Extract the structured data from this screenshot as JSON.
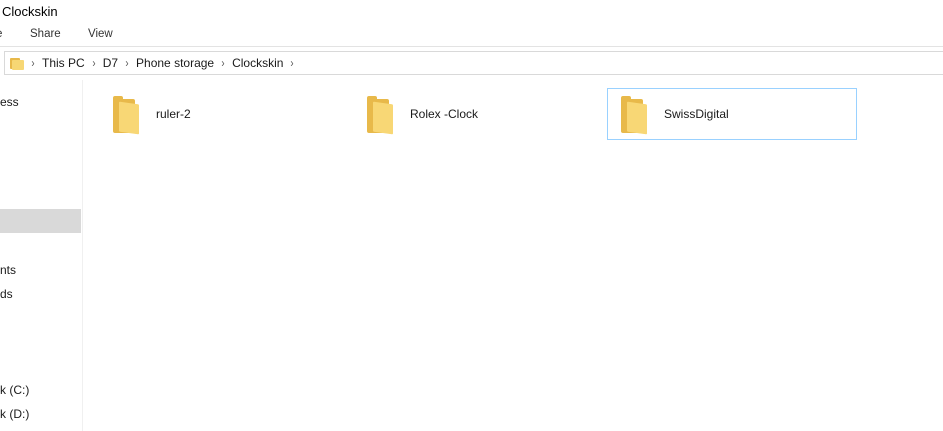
{
  "window": {
    "title": "Clockskin"
  },
  "ribbon": {
    "tabs": [
      {
        "label": "e"
      },
      {
        "label": "Share"
      },
      {
        "label": "View"
      }
    ]
  },
  "address_bar": {
    "crumbs": [
      "This PC",
      "D7",
      "Phone storage",
      "Clockskin"
    ],
    "separator": "›"
  },
  "nav_pane": {
    "items": [
      {
        "label": "ess"
      },
      {
        "label": "nts"
      },
      {
        "label": "ds"
      },
      {
        "label": "k (C:)"
      },
      {
        "label": "k (D:)"
      }
    ]
  },
  "content": {
    "items": [
      {
        "name": "ruler-2",
        "type": "folder",
        "selected": false
      },
      {
        "name": "Rolex -Clock",
        "type": "folder",
        "selected": false
      },
      {
        "name": "SwissDigital",
        "type": "folder",
        "selected": true
      }
    ]
  },
  "colors": {
    "folder_back": "#e8b94a",
    "folder_front": "#f8d775",
    "selection_border": "#99d1ff",
    "nav_selected_bg": "#d9d9d9"
  }
}
